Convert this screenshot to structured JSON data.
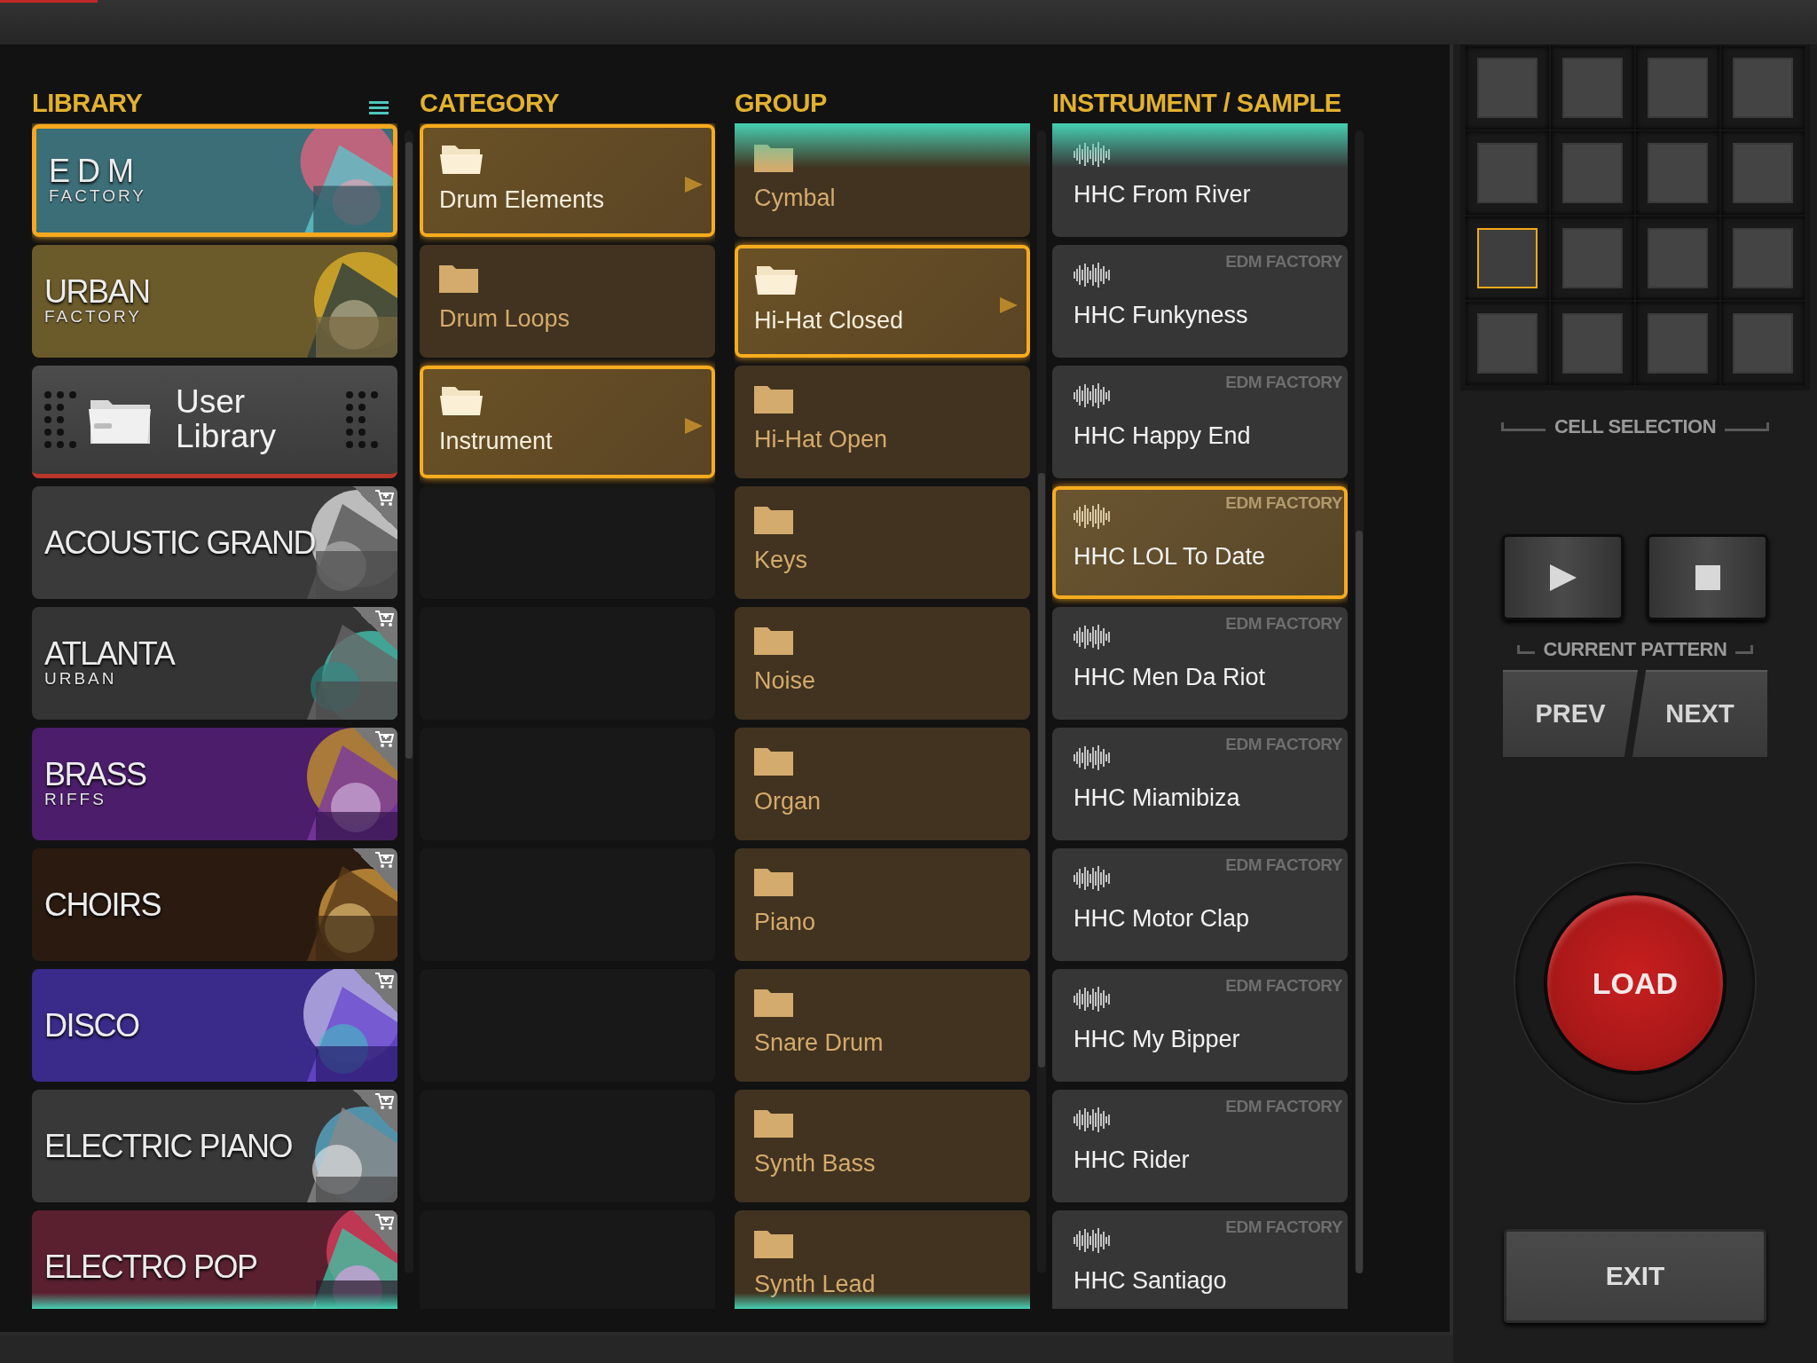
{
  "library": {
    "title": "LIBRARY",
    "items": [
      {
        "kind": "banner",
        "title": "EDM",
        "subtitle": "FACTORY",
        "selected": true,
        "purchasable": false
      },
      {
        "kind": "banner",
        "title": "URBAN",
        "subtitle": "FACTORY",
        "selected": false,
        "purchasable": false
      },
      {
        "kind": "user",
        "title": "User Library",
        "selected": false,
        "purchasable": false
      },
      {
        "kind": "banner",
        "title": "ACOUSTIC GRAND",
        "selected": false,
        "purchasable": true
      },
      {
        "kind": "banner",
        "title": "ATLANTA",
        "subtitle": "URBAN",
        "selected": false,
        "purchasable": true
      },
      {
        "kind": "banner",
        "title": "BRASS",
        "subtitle": "RIFFS",
        "selected": false,
        "purchasable": true
      },
      {
        "kind": "banner",
        "title": "CHOIRS",
        "selected": false,
        "purchasable": true
      },
      {
        "kind": "banner",
        "title": "DISCO",
        "selected": false,
        "purchasable": true
      },
      {
        "kind": "banner",
        "title": "ELECTRIC PIANO",
        "selected": false,
        "purchasable": true
      },
      {
        "kind": "banner",
        "title": "ELECTRO POP",
        "selected": false,
        "purchasable": true
      }
    ]
  },
  "category": {
    "title": "CATEGORY",
    "items": [
      {
        "label": "Drum Elements",
        "selected": true
      },
      {
        "label": "Drum Loops",
        "selected": false
      },
      {
        "label": "Instrument",
        "selected": true
      }
    ]
  },
  "group": {
    "title": "GROUP",
    "items": [
      {
        "label": "Cymbal",
        "selected": false
      },
      {
        "label": "Hi-Hat Closed",
        "selected": true
      },
      {
        "label": "Hi-Hat Open",
        "selected": false
      },
      {
        "label": "Keys",
        "selected": false
      },
      {
        "label": "Noise",
        "selected": false
      },
      {
        "label": "Organ",
        "selected": false
      },
      {
        "label": "Piano",
        "selected": false
      },
      {
        "label": "Snare Drum",
        "selected": false
      },
      {
        "label": "Synth Bass",
        "selected": false
      },
      {
        "label": "Synth Lead",
        "selected": false
      }
    ]
  },
  "instruments": {
    "title": "INSTRUMENT / SAMPLE",
    "items": [
      {
        "name": "HHC From River",
        "selected": false
      },
      {
        "name": "HHC Funkyness",
        "source": "EDM FACTORY",
        "selected": false
      },
      {
        "name": "HHC Happy End",
        "source": "EDM FACTORY",
        "selected": false
      },
      {
        "name": "HHC LOL To Date",
        "source": "EDM FACTORY",
        "selected": true
      },
      {
        "name": "HHC Men Da Riot",
        "source": "EDM FACTORY",
        "selected": false
      },
      {
        "name": "HHC Miamibiza",
        "source": "EDM FACTORY",
        "selected": false
      },
      {
        "name": "HHC Motor Clap",
        "source": "EDM FACTORY",
        "selected": false
      },
      {
        "name": "HHC My Bipper",
        "source": "EDM FACTORY",
        "selected": false
      },
      {
        "name": "HHC Rider",
        "source": "EDM FACTORY",
        "selected": false
      },
      {
        "name": "HHC Santiago",
        "source": "EDM FACTORY",
        "selected": false
      }
    ]
  },
  "cell_selection": {
    "label": "CELL SELECTION",
    "cells": [
      {
        "selected": false
      },
      {
        "selected": false
      },
      {
        "selected": false
      },
      {
        "selected": false
      },
      {
        "selected": false
      },
      {
        "selected": false
      },
      {
        "selected": false
      },
      {
        "selected": false
      },
      {
        "selected": true
      },
      {
        "selected": false
      },
      {
        "selected": false
      },
      {
        "selected": false
      },
      {
        "selected": false
      },
      {
        "selected": false
      },
      {
        "selected": false
      },
      {
        "selected": false
      }
    ]
  },
  "current_pattern": {
    "label": "CURRENT PATTERN",
    "transport": [
      {
        "kind": "play"
      },
      {
        "kind": "stop"
      }
    ],
    "buttons": [
      "PREV",
      "NEXT"
    ]
  },
  "load_button": "LOAD",
  "exit_button": "EXIT"
}
